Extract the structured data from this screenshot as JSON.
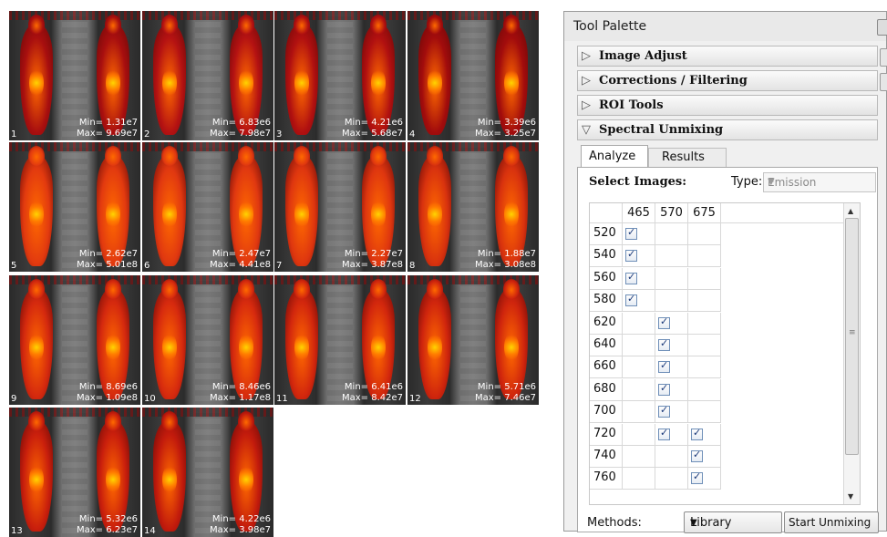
{
  "thumbnails": [
    {
      "index": "1",
      "min": "Min= 1.31e7",
      "max": "Max= 9.69e7"
    },
    {
      "index": "2",
      "min": "Min= 6.83e6",
      "max": "Max= 7.98e7"
    },
    {
      "index": "3",
      "min": "Min= 4.21e6",
      "max": "Max= 5.68e7"
    },
    {
      "index": "4",
      "min": "Min= 3.39e6",
      "max": "Max= 3.25e7"
    },
    {
      "index": "5",
      "min": "Min= 2.62e7",
      "max": "Max= 5.01e8"
    },
    {
      "index": "6",
      "min": "Min= 2.47e7",
      "max": "Max= 4.41e8"
    },
    {
      "index": "7",
      "min": "Min= 2.27e7",
      "max": "Max= 3.87e8"
    },
    {
      "index": "8",
      "min": "Min= 1.88e7",
      "max": "Max= 3.08e8"
    },
    {
      "index": "9",
      "min": "Min= 8.69e6",
      "max": "Max= 1.09e8"
    },
    {
      "index": "10",
      "min": "Min= 8.46e6",
      "max": "Max= 1.17e8"
    },
    {
      "index": "11",
      "min": "Min= 6.41e6",
      "max": "Max= 8.42e7"
    },
    {
      "index": "12",
      "min": "Min= 5.71e6",
      "max": "Max= 7.46e7"
    },
    {
      "index": "13",
      "min": "Min= 5.32e6",
      "max": "Max= 6.23e7"
    },
    {
      "index": "14",
      "min": "Min= 4.22e6",
      "max": "Max= 3.98e7"
    }
  ],
  "palette": {
    "title": "Tool Palette",
    "sections": [
      {
        "label": "Image Adjust",
        "expanded": false
      },
      {
        "label": "Corrections / Filtering",
        "expanded": false
      },
      {
        "label": "ROI Tools",
        "expanded": false
      },
      {
        "label": "Spectral Unmixing",
        "expanded": true
      }
    ],
    "tabs": [
      {
        "label": "Analyze",
        "active": true
      },
      {
        "label": "Results",
        "active": false
      }
    ],
    "select_images_label": "Select Images:",
    "type_label": "Type:",
    "type_value": "Emission",
    "table": {
      "columns": [
        "465",
        "570",
        "675"
      ],
      "rows": [
        {
          "label": "520",
          "checked": [
            true,
            false,
            false
          ]
        },
        {
          "label": "540",
          "checked": [
            true,
            false,
            false
          ]
        },
        {
          "label": "560",
          "checked": [
            true,
            false,
            false
          ]
        },
        {
          "label": "580",
          "checked": [
            true,
            false,
            false
          ]
        },
        {
          "label": "620",
          "checked": [
            false,
            true,
            false
          ]
        },
        {
          "label": "640",
          "checked": [
            false,
            true,
            false
          ]
        },
        {
          "label": "660",
          "checked": [
            false,
            true,
            false
          ]
        },
        {
          "label": "680",
          "checked": [
            false,
            true,
            false
          ]
        },
        {
          "label": "700",
          "checked": [
            false,
            true,
            false
          ]
        },
        {
          "label": "720",
          "checked": [
            false,
            true,
            true
          ]
        },
        {
          "label": "740",
          "checked": [
            false,
            false,
            true
          ]
        },
        {
          "label": "760",
          "checked": [
            false,
            false,
            true
          ]
        }
      ]
    },
    "methods_label": "Methods:",
    "methods_value": "Library",
    "start_button": "Start Unmixing"
  }
}
